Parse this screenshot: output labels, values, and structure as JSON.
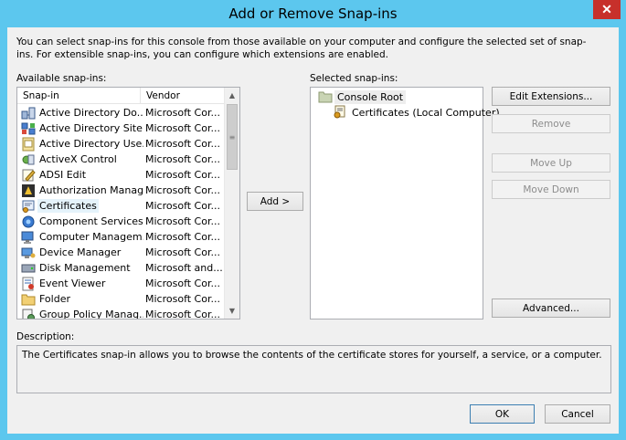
{
  "window": {
    "title": "Add or Remove Snap-ins",
    "close_glyph": "✕"
  },
  "intro": "You can select snap-ins for this console from those available on your computer and configure the selected set of snap-ins. For extensible snap-ins, you can configure which extensions are enabled.",
  "available": {
    "label": "Available snap-ins:",
    "columns": [
      "Snap-in",
      "Vendor"
    ],
    "rows": [
      {
        "name": "Active Directory Do...",
        "vendor": "Microsoft Cor...",
        "icon": "ad-domains-icon"
      },
      {
        "name": "Active Directory Site...",
        "vendor": "Microsoft Cor...",
        "icon": "ad-sites-icon"
      },
      {
        "name": "Active Directory Use...",
        "vendor": "Microsoft Cor...",
        "icon": "ad-users-icon"
      },
      {
        "name": "ActiveX Control",
        "vendor": "Microsoft Cor...",
        "icon": "activex-icon"
      },
      {
        "name": "ADSI Edit",
        "vendor": "Microsoft Cor...",
        "icon": "adsi-edit-icon"
      },
      {
        "name": "Authorization Manager",
        "vendor": "Microsoft Cor...",
        "icon": "authorization-icon"
      },
      {
        "name": "Certificates",
        "vendor": "Microsoft Cor...",
        "icon": "certificates-icon"
      },
      {
        "name": "Component Services",
        "vendor": "Microsoft Cor...",
        "icon": "component-services-icon"
      },
      {
        "name": "Computer Managem...",
        "vendor": "Microsoft Cor...",
        "icon": "computer-management-icon"
      },
      {
        "name": "Device Manager",
        "vendor": "Microsoft Cor...",
        "icon": "device-manager-icon"
      },
      {
        "name": "Disk Management",
        "vendor": "Microsoft and...",
        "icon": "disk-management-icon"
      },
      {
        "name": "Event Viewer",
        "vendor": "Microsoft Cor...",
        "icon": "event-viewer-icon"
      },
      {
        "name": "Folder",
        "vendor": "Microsoft Cor...",
        "icon": "folder-icon"
      },
      {
        "name": "Group Policy Manag...",
        "vendor": "Microsoft Cor...",
        "icon": "group-policy-icon"
      }
    ],
    "selected_index": 6,
    "scroll_up": "▲",
    "scroll_down": "▼",
    "thumb_grip": "≡"
  },
  "add_button": "Add >",
  "selected": {
    "label": "Selected snap-ins:",
    "root": "Console Root",
    "child": "Certificates (Local Computer)"
  },
  "buttons": {
    "edit_extensions": "Edit Extensions...",
    "remove": "Remove",
    "move_up": "Move Up",
    "move_down": "Move Down",
    "advanced": "Advanced...",
    "ok": "OK",
    "cancel": "Cancel"
  },
  "description": {
    "label": "Description:",
    "text": "The Certificates snap-in allows you to browse the contents of the certificate stores for yourself, a service, or a computer."
  },
  "colors": {
    "titlebar": "#5cc7ee",
    "close_button": "#c7302b",
    "dialog_bg": "#f0f0f0",
    "selection": "#e5f3fb"
  }
}
